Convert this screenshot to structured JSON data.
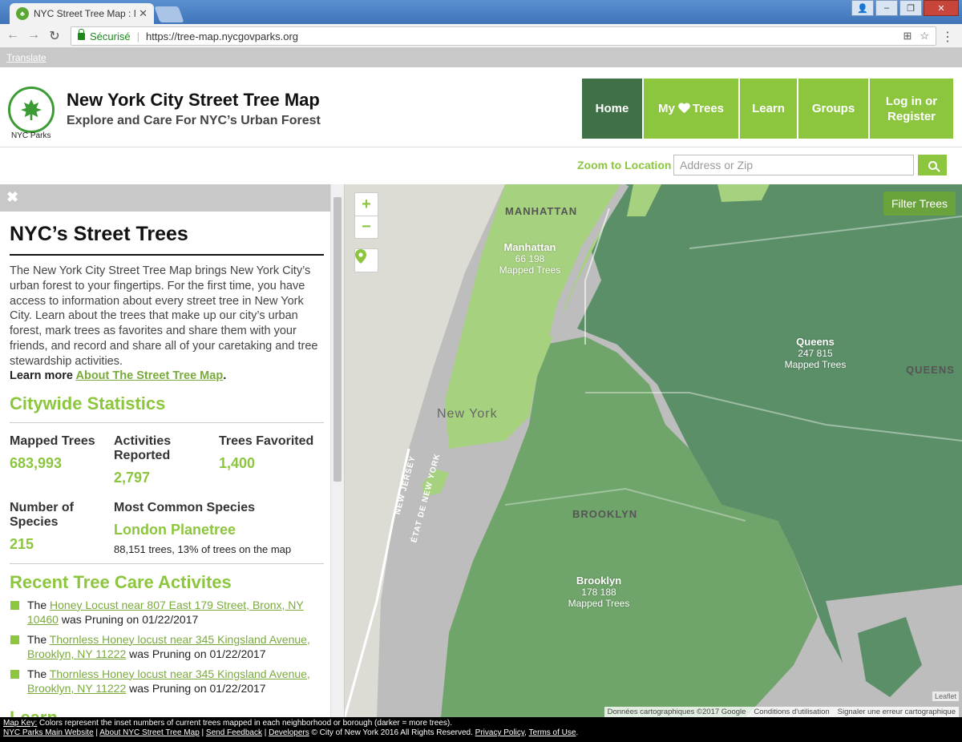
{
  "browser": {
    "tab_title": "NYC Street Tree Map : N",
    "secure_label": "Sécurisé",
    "url": "https://tree-map.nycgovparks.org",
    "translate_link": "Translate"
  },
  "header": {
    "logo_text": "NYC Parks",
    "title": "New York City Street Tree Map",
    "subtitle": "Explore and Care For NYC’s Urban Forest",
    "nav": {
      "home": "Home",
      "my_trees_prefix": "My",
      "my_trees_suffix": "Trees",
      "learn": "Learn",
      "groups": "Groups",
      "login_line1": "Log in or",
      "login_line2": "Register"
    },
    "zoom_label": "Zoom to Location",
    "zoom_placeholder": "Address or Zip"
  },
  "sidebar": {
    "title": "NYC’s Street Trees",
    "intro": "The New York City Street Tree Map brings New York City’s urban forest to your fingertips. For the first time, you have access to information about every street tree in New York City. Learn about the trees that make up our city’s urban forest, mark trees as favorites and share them with your friends, and record and share all of your caretaking and tree stewardship activities.",
    "learn_more_prefix": "Learn more",
    "learn_more_link": "About The Street Tree Map",
    "learn_more_suffix": ".",
    "stats_heading": "Citywide Statistics",
    "stats": {
      "mapped_label": "Mapped Trees",
      "mapped_value": "683,993",
      "activities_label": "Activities Reported",
      "activities_value": "2,797",
      "favorited_label": "Trees Favorited",
      "favorited_value": "1,400",
      "species_label": "Number of Species",
      "species_value": "215",
      "common_label": "Most Common Species",
      "common_value": "London Planetree",
      "common_note": "88,151 trees, 13% of trees on the map"
    },
    "recent_heading": "Recent Tree Care Activites",
    "activities": [
      {
        "prefix": "The",
        "link": "Honey Locust near 807 East 179 Street, Bronx, NY 10460",
        "suffix": "was Pruning on 01/22/2017"
      },
      {
        "prefix": "The",
        "link": "Thornless Honey locust near 345 Kingsland Avenue, Brooklyn, NY 11222",
        "suffix": "was Pruning on 01/22/2017"
      },
      {
        "prefix": "The",
        "link": "Thornless Honey locust near 345 Kingsland Avenue, Brooklyn, NY 11222",
        "suffix": "was Pruning on 01/22/2017"
      }
    ],
    "learn_heading": "Learn"
  },
  "map": {
    "filter_button": "Filter Trees",
    "zoom_in": "+",
    "zoom_out": "−",
    "boroughs": [
      {
        "name": "Manhattan",
        "count": "66 198",
        "unit": "Mapped Trees"
      },
      {
        "name": "Queens",
        "count": "247 815",
        "unit": "Mapped Trees"
      },
      {
        "name": "Brooklyn",
        "count": "178 188",
        "unit": "Mapped Trees"
      }
    ],
    "area_names": {
      "manhattan": "MANHATTAN",
      "queens": "QUEENS",
      "brooklyn": "BROOKLYN",
      "new_york": "New York",
      "new_jersey": "NEW JERSEY",
      "etat": "ÉTAT DE NEW YORK"
    },
    "attribution": {
      "data": "Données cartographiques ©2017 Google",
      "terms": "Conditions d'utilisation",
      "report": "Signaler une erreur cartographique",
      "leaflet": "Leaflet"
    },
    "colors": {
      "manhattan": "#a6d17f",
      "brooklyn": "#6fa46a",
      "queens": "#5b8f68",
      "water": "#bdbdbd"
    }
  },
  "footer": {
    "map_key_label": "Map Key:",
    "map_key_text": "Colors represent the inset numbers of current trees mapped in each neighborhood or borough (darker = more trees).",
    "links": [
      "NYC Parks Main Website",
      "About NYC Street Tree Map",
      "Send Feedback",
      "Developers"
    ],
    "copyright": "© City of New York 2016 All Rights Reserved.",
    "policy_links": [
      "Privacy Policy",
      "Terms of Use"
    ]
  }
}
